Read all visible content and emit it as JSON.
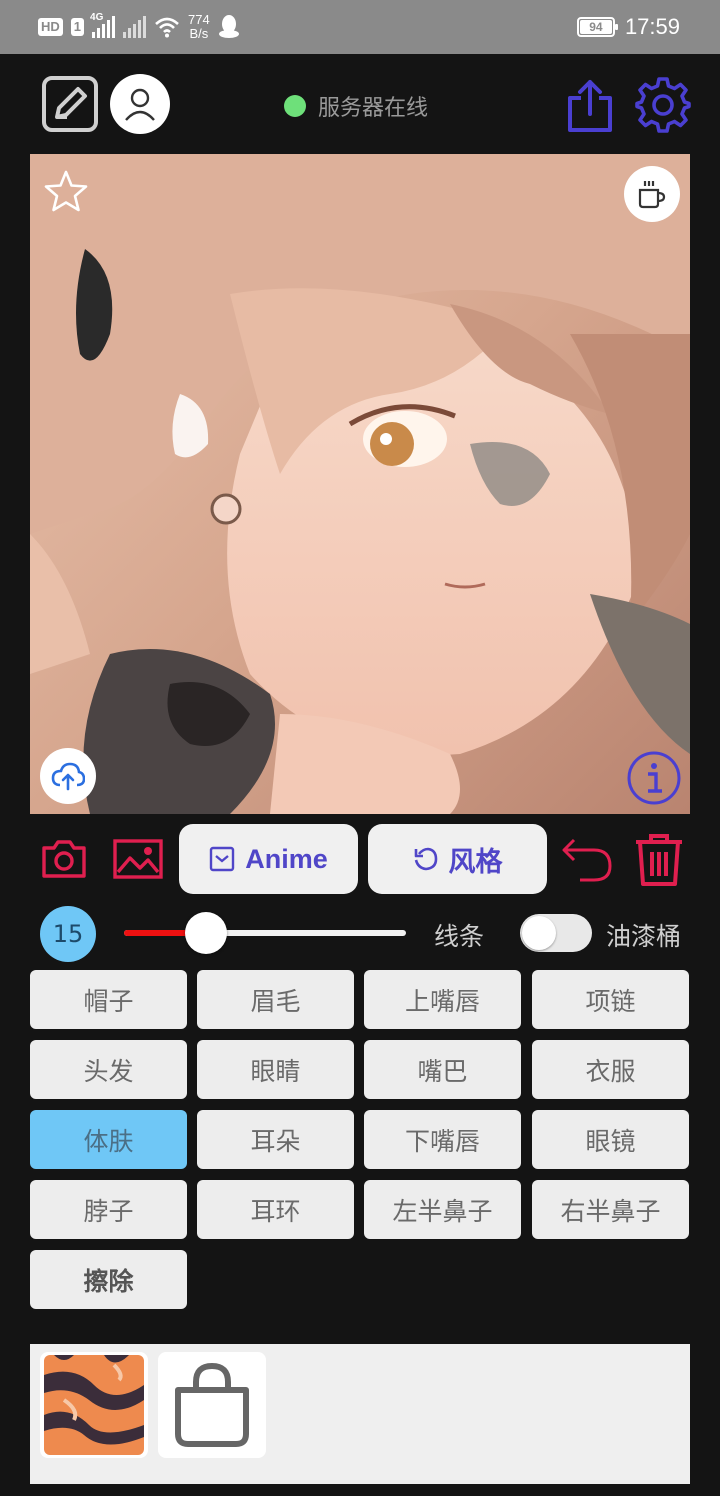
{
  "status_bar": {
    "hd_label": "HD",
    "sim_label": "1",
    "network_label": "4G",
    "speed_value": "774",
    "speed_unit": "B/s",
    "battery_percent": 94,
    "battery_text": "94",
    "time": "17:59"
  },
  "header": {
    "server_status": "服务器在线",
    "server_status_color": "#6ee07a",
    "icons": [
      "draw-icon",
      "user-icon",
      "share-icon",
      "settings-icon"
    ]
  },
  "canvas": {
    "overlay_icons": [
      "star-icon",
      "coffee-icon",
      "cloud-upload-icon",
      "info-icon"
    ]
  },
  "toolbar": {
    "anime_label": "Anime",
    "style_label": "风格",
    "accent_color": "#5046c8",
    "danger_color": "#e01f4f"
  },
  "brush": {
    "size": "15",
    "slider_fraction": 0.29,
    "line_label": "线条",
    "bucket_label": "油漆桶",
    "bucket_enabled": false
  },
  "parts": [
    "帽子",
    "眉毛",
    "上嘴唇",
    "项链",
    "头发",
    "眼睛",
    "嘴巴",
    "衣服",
    "体肤",
    "耳朵",
    "下嘴唇",
    "眼镜",
    "脖子",
    "耳环",
    "左半鼻子",
    "右半鼻子"
  ],
  "selected_part": "体肤",
  "erase_label": "擦除"
}
